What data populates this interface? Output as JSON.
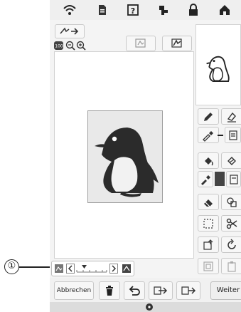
{
  "callout": {
    "marker": "①"
  },
  "status_bar": {
    "icons": [
      "wifi-icon",
      "document-icon",
      "help-icon",
      "needle-icon",
      "lock-icon",
      "home-icon"
    ]
  },
  "toolbar_top": {
    "icons": [
      "convert-arrow-icon",
      "zoom-100-icon",
      "zoom-out-icon",
      "zoom-in-icon",
      "layer-image-icon",
      "layer-pattern-icon"
    ]
  },
  "canvas": {
    "image": "penguin-icon"
  },
  "tools": {
    "icons": [
      "pencil-icon",
      "line-eraser-icon",
      "line-color-dropper-icon",
      "line-style-icon",
      "paint-bucket-icon",
      "region-eraser-icon",
      "fill-dropper-icon",
      "fill-color-icon",
      "eraser-icon",
      "duplicate-icon",
      "select-icon",
      "cut-icon",
      "resize-icon",
      "rotate-icon",
      "paste-icon",
      "clipboard-icon"
    ],
    "fill_color": "#444444"
  },
  "zoom_bar": {
    "icons": [
      "image-view-icon",
      "scroll-left-icon",
      "scroll-right-icon",
      "scan-view-icon"
    ]
  },
  "bottom_bar": {
    "cancel_label": "Abbrechen",
    "next_label": "Weiter",
    "icons": [
      "trash-icon",
      "undo-icon",
      "import-icon",
      "export-icon"
    ]
  },
  "colors": {
    "screen_bg": "#f4f4f4",
    "ink": "#222222"
  }
}
